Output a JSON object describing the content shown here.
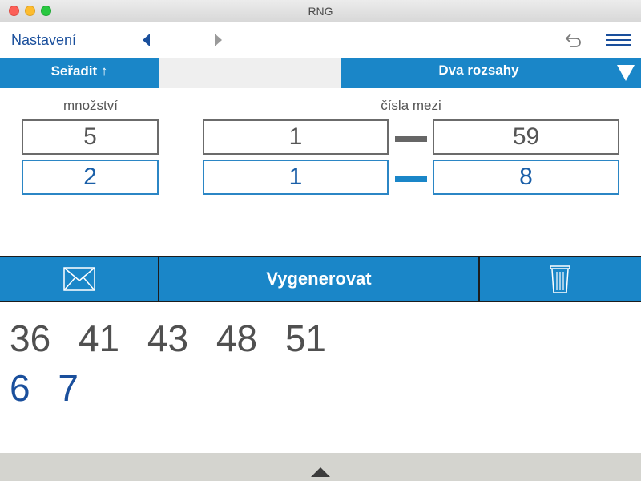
{
  "window": {
    "title": "RNG"
  },
  "toolbar": {
    "settings_label": "Nastavení"
  },
  "modes": {
    "sort_label": "Seřadit ↑",
    "range_label": "Dva rozsahy"
  },
  "labels": {
    "quantity": "množství",
    "between": "čísla mezi"
  },
  "range1": {
    "quantity": "5",
    "min": "1",
    "max": "59"
  },
  "range2": {
    "quantity": "2",
    "min": "1",
    "max": "8"
  },
  "actions": {
    "generate_label": "Vygenerovat"
  },
  "results": {
    "row1": [
      "36",
      "41",
      "43",
      "48",
      "51"
    ],
    "row2": [
      "6",
      "7"
    ]
  },
  "icons": {
    "mail": "envelope-icon",
    "trash": "trash-icon",
    "undo": "undo-icon",
    "menu": "hamburger-menu-icon"
  },
  "colors": {
    "accent": "#1a86c8",
    "text_blue": "#1a4f9c",
    "text_gray": "#505050"
  }
}
